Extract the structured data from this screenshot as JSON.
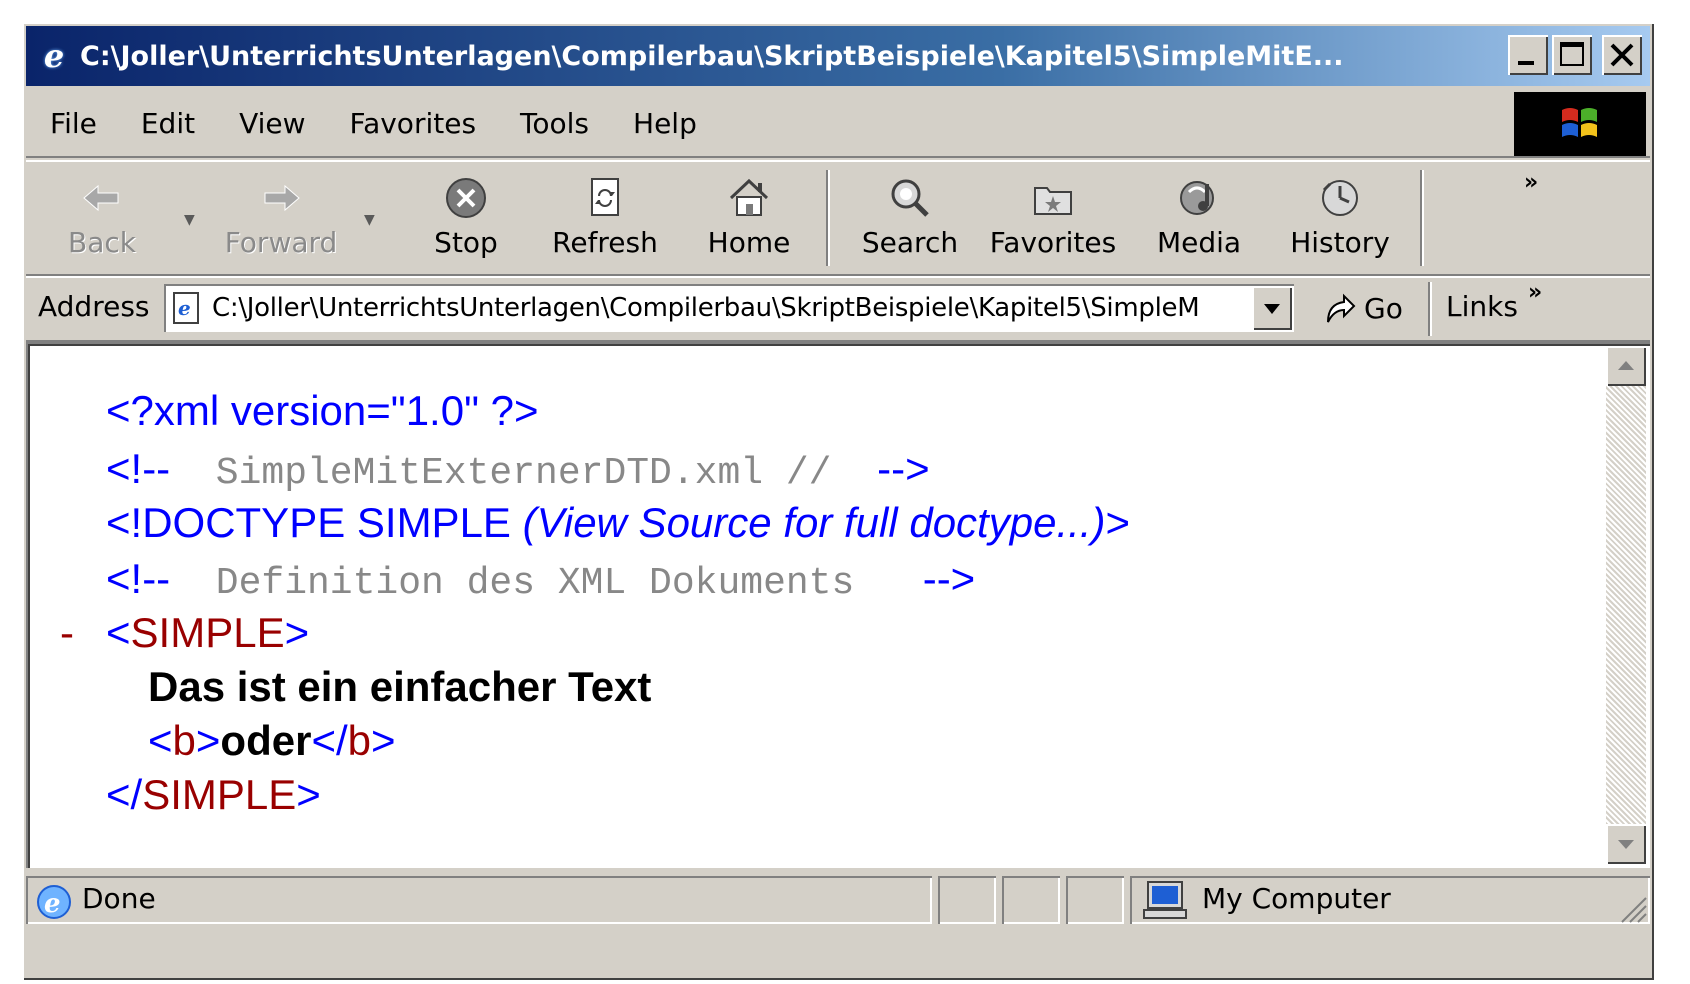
{
  "window": {
    "title": "C:\\Joller\\UnterrichtsUnterlagen\\Compilerbau\\SkriptBeispiele\\Kapitel5\\SimpleMitE..."
  },
  "menu": {
    "file": "File",
    "edit": "Edit",
    "view": "View",
    "favorites": "Favorites",
    "tools": "Tools",
    "help": "Help"
  },
  "toolbar": {
    "back": "Back",
    "forward": "Forward",
    "stop": "Stop",
    "refresh": "Refresh",
    "home": "Home",
    "search": "Search",
    "favorites": "Favorites",
    "media": "Media",
    "history": "History",
    "more": "»"
  },
  "address": {
    "label": "Address",
    "value": "C:\\Joller\\UnterrichtsUnterlagen\\Compilerbau\\SkriptBeispiele\\Kapitel5\\SimpleM",
    "go": "Go",
    "links": "Links",
    "links_more": "»"
  },
  "content": {
    "xml_decl": "<?xml version=\"1.0\" ?>",
    "comment1_open": "<!--",
    "comment1_text": "  SimpleMitExternerDTD.xml //  ",
    "comment1_close": "-->",
    "doctype_open": "<!DOCTYPE SIMPLE ",
    "doctype_note": "(View Source for full doctype...)",
    "doctype_close": ">",
    "comment2_open": "<!--",
    "comment2_text": "  Definition des XML Dokuments   ",
    "comment2_close": "-->",
    "collapse_marker": "-",
    "simple_open_lt": "<",
    "simple_tag": "SIMPLE",
    "simple_open_gt": ">",
    "text_line": "Das ist ein einfacher Text",
    "b_open_lt": "<",
    "b_tag": "b",
    "b_open_gt": ">",
    "b_text": "oder",
    "b_close_lt": "</",
    "b_close_tag": "b",
    "b_close_gt": ">",
    "simple_close_lt": "</",
    "simple_close_tag": "SIMPLE",
    "simple_close_gt": ">"
  },
  "status": {
    "text": "Done",
    "zone": "My Computer"
  }
}
